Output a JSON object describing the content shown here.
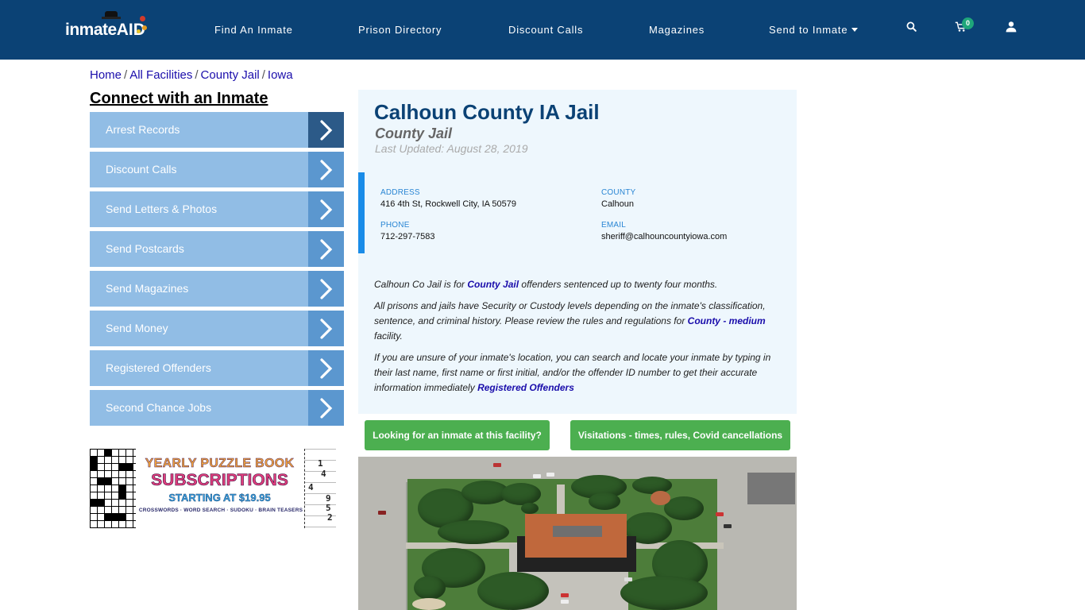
{
  "header": {
    "logo": {
      "part1": "inmate",
      "part2": "AID"
    },
    "nav": [
      {
        "label": "Find An Inmate"
      },
      {
        "label": "Prison Directory"
      },
      {
        "label": "Discount Calls"
      },
      {
        "label": "Magazines"
      },
      {
        "label": "Send to Inmate",
        "has_dropdown": true
      }
    ],
    "icons": [
      "search-icon",
      "cart-icon",
      "user-icon"
    ],
    "cart_count": "0",
    "colors": {
      "bar": "#0b4275",
      "badge": "#1fa67a"
    }
  },
  "breadcrumb": [
    {
      "label": "Home"
    },
    {
      "label": "All Facilities"
    },
    {
      "label": "County Jail"
    },
    {
      "label": "Iowa"
    }
  ],
  "sidebar": {
    "title": "Connect with an Inmate",
    "items": [
      {
        "label": "Arrest Records",
        "active": true
      },
      {
        "label": "Discount Calls"
      },
      {
        "label": "Send Letters & Photos"
      },
      {
        "label": "Send Postcards"
      },
      {
        "label": "Send Magazines"
      },
      {
        "label": "Send Money"
      },
      {
        "label": "Registered Offenders"
      },
      {
        "label": "Second Chance Jobs"
      }
    ],
    "ad": {
      "line1": "YEARLY PUZZLE BOOK",
      "line2": "SUBSCRIPTIONS",
      "line3": "STARTING AT $19.95",
      "line4": "CROSSWORDS · WORD SEARCH · SUDOKU · BRAIN TEASERS",
      "sudoku_digits": [
        "1",
        "4",
        "4",
        "9",
        "5",
        "2"
      ]
    }
  },
  "facility": {
    "name": "Calhoun County IA Jail",
    "type": "County Jail",
    "last_updated": "Last Updated: August 28, 2019",
    "info": {
      "address_label": "ADDRESS",
      "address": "416 4th St, Rockwell City, IA 50579",
      "county_label": "COUNTY",
      "county": "Calhoun",
      "phone_label": "PHONE",
      "phone": "712-297-7583",
      "email_label": "EMAIL",
      "email": "sheriff@calhouncountyiowa.com"
    },
    "description": {
      "p1_before": "Calhoun Co Jail is for ",
      "p1_link": "County Jail",
      "p1_after": " offenders sentenced up to twenty four months.",
      "p2_before": "All prisons and jails have Security or Custody levels depending on the inmate's classification, sentence, and criminal history. Please review the rules and regulations for ",
      "p2_link": "County - medium",
      "p2_after": " facility.",
      "p3_before": "If you are unsure of your inmate's location, you can search and locate your inmate by typing in their last name, first name or first initial, and/or the offender ID number to get their accurate information immediately ",
      "p3_link": "Registered Offenders"
    },
    "buttons": {
      "find_inmate": "Looking for an inmate at this facility?",
      "visitation": "Visitations - times, rules, Covid cancellations"
    },
    "colors": {
      "title": "#0b4275",
      "accent_bar": "#1a8ce8",
      "button": "#4caf50",
      "card_bg": "#eef7fd"
    }
  }
}
